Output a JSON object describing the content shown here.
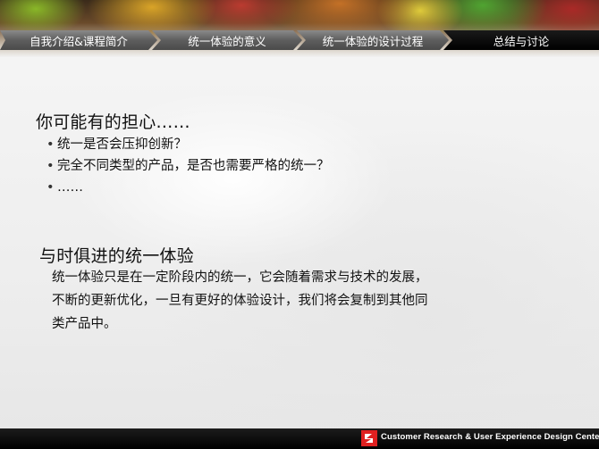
{
  "nav": {
    "items": [
      {
        "label": "自我介绍&课程简介",
        "state": "inactive"
      },
      {
        "label": "统一体验的意义",
        "state": "inactive"
      },
      {
        "label": "统一体验的设计过程",
        "state": "inactive"
      },
      {
        "label": "总结与讨论",
        "state": "active"
      }
    ]
  },
  "section1": {
    "title": "你可能有的担心……",
    "bullets": [
      "统一是否会压抑创新？",
      "完全不同类型的产品，是否也需要严格的统一？",
      "……"
    ]
  },
  "section2": {
    "title": "与时俱进的统一体验",
    "lines": [
      "统一体验只是在一定阶段内的统一，它会随着需求与技术的发展，",
      "不断的更新优化，一旦有更好的体验设计，我们将会复制到其他同",
      "类产品中。"
    ]
  },
  "footer": {
    "text": "Customer Research & User Experience Design Center",
    "logo_icon": "cdc-logo-icon",
    "logo_color": "#e02020"
  },
  "colors": {
    "nav_inactive": "#5e5e5e",
    "nav_active": "#000000",
    "text": "#111111"
  }
}
